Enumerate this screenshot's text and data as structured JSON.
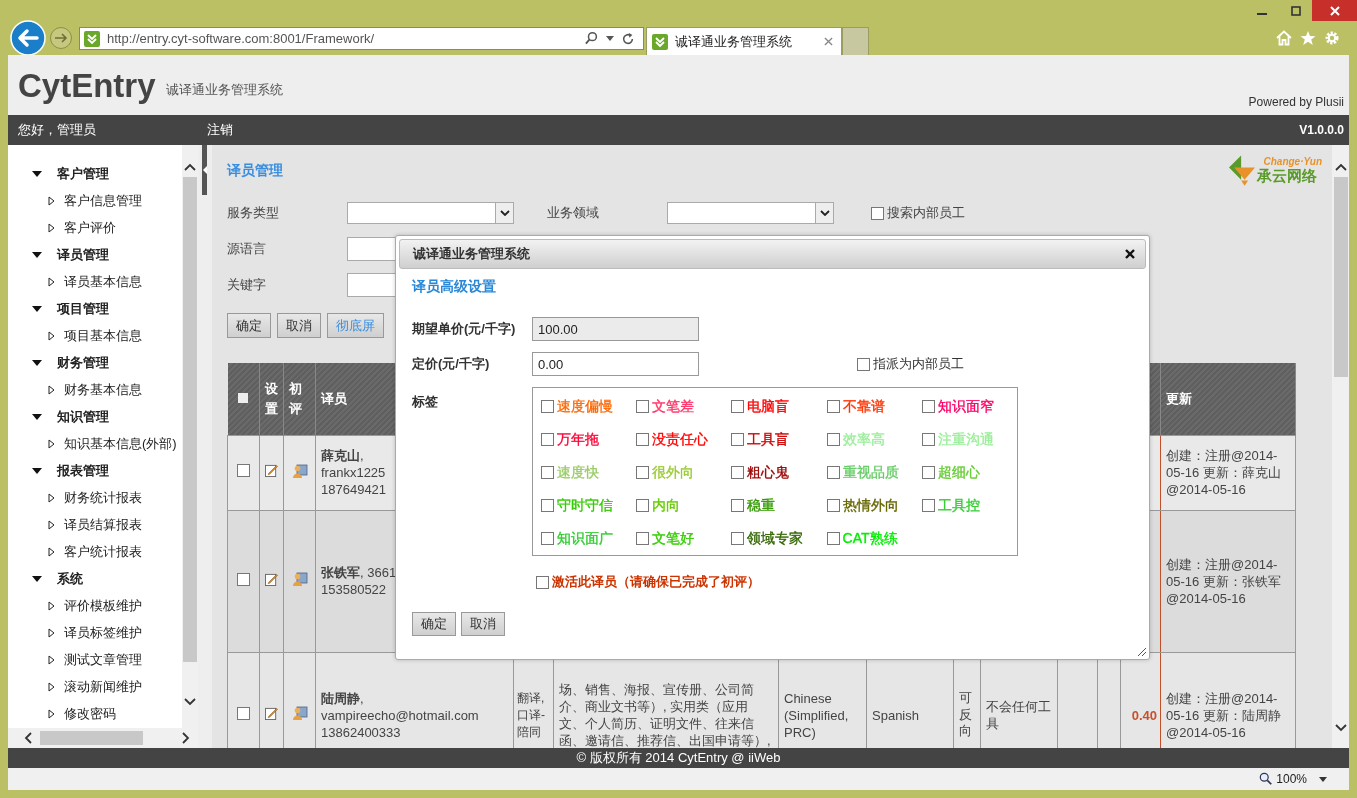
{
  "browser": {
    "address": "http://entry.cyt-software.com:8001/Framework/",
    "tabs": [
      {
        "title": "诚译通业务管理系统",
        "selected": true
      }
    ]
  },
  "header": {
    "logo": "CytEntry",
    "subtitle": "诚译通业务管理系统",
    "powered_by": "Powered by Plusii"
  },
  "top_bar": {
    "greeting": "您好，管理员",
    "logout": "注销",
    "version": "V1.0.0.0"
  },
  "sidebar": {
    "items": [
      {
        "label": "客户管理",
        "expanded": true,
        "children": [
          {
            "label": "客户信息管理"
          },
          {
            "label": "客户评价"
          }
        ]
      },
      {
        "label": "译员管理",
        "expanded": true,
        "children": [
          {
            "label": "译员基本信息"
          }
        ]
      },
      {
        "label": "项目管理",
        "expanded": true,
        "children": [
          {
            "label": "项目基本信息"
          }
        ]
      },
      {
        "label": "财务管理",
        "expanded": true,
        "children": [
          {
            "label": "财务基本信息"
          }
        ]
      },
      {
        "label": "知识管理",
        "expanded": true,
        "children": [
          {
            "label": "知识基本信息(外部)"
          }
        ]
      },
      {
        "label": "报表管理",
        "expanded": true,
        "children": [
          {
            "label": "财务统计报表"
          },
          {
            "label": "译员结算报表"
          },
          {
            "label": "客户统计报表"
          }
        ]
      },
      {
        "label": "系统",
        "expanded": true,
        "children": [
          {
            "label": "评价模板维护"
          },
          {
            "label": "译员标签维护"
          },
          {
            "label": "测试文章管理"
          },
          {
            "label": "滚动新闻维护"
          },
          {
            "label": "修改密码"
          }
        ]
      }
    ]
  },
  "content": {
    "title": "译员管理",
    "brand": {
      "tagline": "Change·Yun",
      "name": "承云网络"
    },
    "filters": [
      {
        "label": "服务类型",
        "kind": "select"
      },
      {
        "label": "业务领域",
        "kind": "select"
      },
      {
        "label": "源语言",
        "kind": "input"
      },
      {
        "label": "关键字",
        "kind": "input"
      }
    ],
    "internal_only": {
      "label": "搜索内部员工",
      "checked": false
    },
    "buttons": [
      {
        "label": "确定",
        "kind": "plain"
      },
      {
        "label": "取消",
        "kind": "plain"
      },
      {
        "label": "彻底屏",
        "kind": "link"
      }
    ],
    "table": {
      "select_all_checked": false,
      "headers": {
        "settings": "设置",
        "review": "初评",
        "translator": "译员",
        "updated": "更新"
      },
      "rows": [
        {
          "checked": false,
          "translator": [
            "**薛克山**,",
            "frankx1225",
            "187649421"
          ],
          "updated": "创建：注册@2014-05-16 更新：薛克山@2014-05-16"
        },
        {
          "checked": false,
          "translator": [
            "**张铁军**, 3661",
            "153580522"
          ],
          "updated": "创建：注册@2014-05-16 更新：张铁军@2014-05-16"
        },
        {
          "checked": false,
          "translator": [
            "**陆周静**,",
            "vampireecho@hotmail.com",
            "13862400333"
          ],
          "service": "翻译,口译-陪同",
          "domain": "场、销售、海报、宣传册、公司简介、商业文书等）, 实用类（应用文、个人简历、证明文件、往来信函、邀请信、推荐信、出国申请等）,",
          "source": "Chinese (Simplified, PRC)",
          "target": "Spanish",
          "reversible": "可反向",
          "tools": "不会任何工具",
          "price": "0.40",
          "updated": "创建：注册@2014-05-16 更新：陆周静@2014-05-16"
        }
      ]
    }
  },
  "dialog": {
    "title": "诚译通业务管理系统",
    "heading": "译员高级设置",
    "fields": [
      {
        "label": "期望单价(元/千字)",
        "value": "100.00",
        "disabled": true
      },
      {
        "label": "定价(元/千字)",
        "value": "0.00",
        "disabled": false
      }
    ],
    "assign_internal": {
      "label": "指派为内部员工",
      "checked": false
    },
    "tags_label": "标签",
    "tags": [
      {
        "label": "速度偏慢",
        "color": "#ff6600",
        "checked": false
      },
      {
        "label": "文笔差",
        "color": "#ff3366",
        "checked": false
      },
      {
        "label": "电脑盲",
        "color": "#ff0000",
        "checked": false
      },
      {
        "label": "不靠谱",
        "color": "#ff3300",
        "checked": false
      },
      {
        "label": "知识面窄",
        "color": "#ff0066",
        "checked": false
      },
      {
        "label": "万年拖",
        "color": "#ff0033",
        "checked": false
      },
      {
        "label": "没责任心",
        "color": "#ff0000",
        "checked": false
      },
      {
        "label": "工具盲",
        "color": "#cc0000",
        "checked": false
      },
      {
        "label": "效率高",
        "color": "#99ee99",
        "checked": false
      },
      {
        "label": "注重沟通",
        "color": "#99ee99",
        "checked": false
      },
      {
        "label": "速度快",
        "color": "#99cc66",
        "checked": false
      },
      {
        "label": "很外向",
        "color": "#99cc33",
        "checked": false
      },
      {
        "label": "粗心鬼",
        "color": "#990000",
        "checked": false
      },
      {
        "label": "重视品质",
        "color": "#66cc66",
        "checked": false
      },
      {
        "label": "超细心",
        "color": "#66cc33",
        "checked": false
      },
      {
        "label": "守时守信",
        "color": "#33cc00",
        "checked": false
      },
      {
        "label": "内向",
        "color": "#66cc00",
        "checked": false
      },
      {
        "label": "稳重",
        "color": "#339900",
        "checked": false
      },
      {
        "label": "热情外向",
        "color": "#666600",
        "checked": false
      },
      {
        "label": "工具控",
        "color": "#33cc33",
        "checked": false
      },
      {
        "label": "知识面广",
        "color": "#33cc33",
        "checked": false
      },
      {
        "label": "文笔好",
        "color": "#33cc00",
        "checked": false
      },
      {
        "label": "领域专家",
        "color": "#336600",
        "checked": false
      },
      {
        "label": "CAT熟练",
        "color": "#00ee00",
        "checked": false
      }
    ],
    "activate": {
      "label": "激活此译员（请确保已完成了初评）",
      "checked": false
    },
    "buttons": [
      "确定",
      "取消"
    ]
  },
  "footer": {
    "copyright": "© 版权所有 2014 CytEntry @ iiWeb"
  },
  "status_bar": {
    "zoom": "100%"
  }
}
